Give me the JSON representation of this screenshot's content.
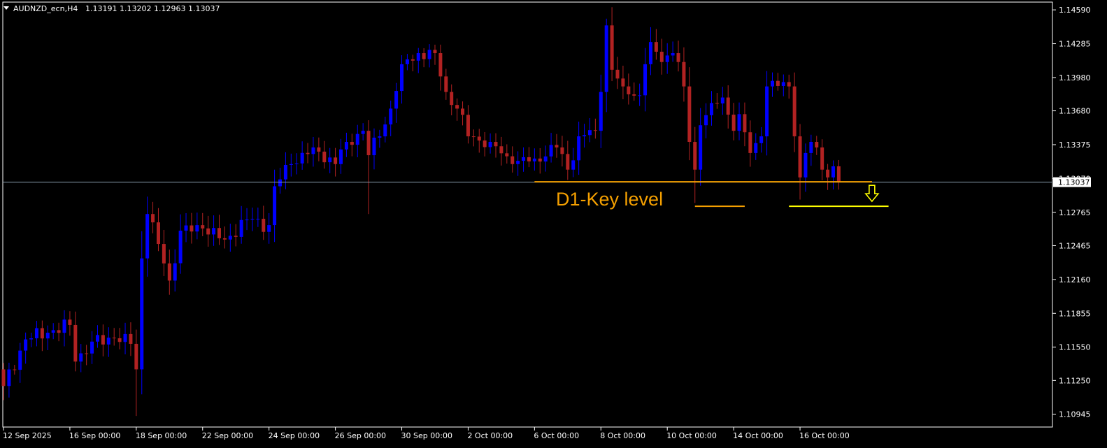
{
  "chart_data": {
    "type": "candlestick",
    "symbol_header": "AUDNZD_ecn,H4",
    "ohlc_header": "1.13191 1.13202 1.12963 1.13037",
    "current_price": 1.13037,
    "current_price_label": "1.13037",
    "ylim": [
      1.1083,
      1.1466
    ],
    "y_ticks": [
      {
        "value": 1.1459,
        "label": "1.14590"
      },
      {
        "value": 1.14285,
        "label": "1.14285"
      },
      {
        "value": 1.1398,
        "label": "1.13980"
      },
      {
        "value": 1.1368,
        "label": "1.13680"
      },
      {
        "value": 1.13375,
        "label": "1.13375"
      },
      {
        "value": 1.1307,
        "label": "1.13070"
      },
      {
        "value": 1.12765,
        "label": "1.12765"
      },
      {
        "value": 1.12465,
        "label": "1.12465"
      },
      {
        "value": 1.1216,
        "label": "1.12160"
      },
      {
        "value": 1.11855,
        "label": "1.11855"
      },
      {
        "value": 1.1155,
        "label": "1.11550"
      },
      {
        "value": 1.1125,
        "label": "1.11250"
      },
      {
        "value": 1.10945,
        "label": "1.10945"
      }
    ],
    "x_ticks": [
      {
        "index": 0,
        "label": "12 Sep 2025"
      },
      {
        "index": 12,
        "label": "16 Sep 00:00"
      },
      {
        "index": 24,
        "label": "18 Sep 00:00"
      },
      {
        "index": 36,
        "label": "22 Sep 00:00"
      },
      {
        "index": 48,
        "label": "24 Sep 00:00"
      },
      {
        "index": 60,
        "label": "26 Sep 00:00"
      },
      {
        "index": 72,
        "label": "30 Sep 00:00"
      },
      {
        "index": 84,
        "label": "2 Oct 00:00"
      },
      {
        "index": 96,
        "label": "6 Oct 00:00"
      },
      {
        "index": 108,
        "label": "8 Oct 00:00"
      },
      {
        "index": 120,
        "label": "10 Oct 00:00"
      },
      {
        "index": 132,
        "label": "14 Oct 00:00"
      },
      {
        "index": 144,
        "label": "16 Oct 00:00"
      }
    ],
    "bull_color": "#0000FF",
    "bear_color": "#B22222",
    "anchors": [
      [
        0,
        1.112
      ],
      [
        4,
        1.1162
      ],
      [
        8,
        1.1168
      ],
      [
        12,
        1.1175
      ],
      [
        13,
        1.1142
      ],
      [
        16,
        1.116
      ],
      [
        20,
        1.1163
      ],
      [
        23,
        1.1158
      ],
      [
        24,
        1.1135
      ],
      [
        25,
        1.1235
      ],
      [
        26,
        1.1275
      ],
      [
        28,
        1.1248
      ],
      [
        30,
        1.1215
      ],
      [
        32,
        1.126
      ],
      [
        36,
        1.1262
      ],
      [
        40,
        1.1252
      ],
      [
        44,
        1.127
      ],
      [
        48,
        1.1265
      ],
      [
        49,
        1.13
      ],
      [
        52,
        1.132
      ],
      [
        56,
        1.1335
      ],
      [
        60,
        1.132
      ],
      [
        62,
        1.134
      ],
      [
        65,
        1.135
      ],
      [
        66,
        1.1328
      ],
      [
        68,
        1.1345
      ],
      [
        70,
        1.137
      ],
      [
        72,
        1.141
      ],
      [
        75,
        1.142
      ],
      [
        78,
        1.142
      ],
      [
        80,
        1.1385
      ],
      [
        82,
        1.137
      ],
      [
        84,
        1.1345
      ],
      [
        88,
        1.134
      ],
      [
        92,
        1.132
      ],
      [
        96,
        1.1325
      ],
      [
        100,
        1.1335
      ],
      [
        102,
        1.1315
      ],
      [
        104,
        1.1345
      ],
      [
        107,
        1.135
      ],
      [
        108,
        1.1385
      ],
      [
        109,
        1.1445
      ],
      [
        110,
        1.1405
      ],
      [
        112,
        1.139
      ],
      [
        115,
        1.1382
      ],
      [
        116,
        1.141
      ],
      [
        117,
        1.143
      ],
      [
        119,
        1.1412
      ],
      [
        121,
        1.142
      ],
      [
        122,
        1.1412
      ],
      [
        123,
        1.139
      ],
      [
        124,
        1.134
      ],
      [
        125,
        1.1315
      ],
      [
        126,
        1.1355
      ],
      [
        128,
        1.1375
      ],
      [
        130,
        1.138
      ],
      [
        132,
        1.135
      ],
      [
        133,
        1.1365
      ],
      [
        135,
        1.133
      ],
      [
        137,
        1.1345
      ],
      [
        138,
        1.139
      ],
      [
        139,
        1.1395
      ],
      [
        142,
        1.139
      ],
      [
        143,
        1.1345
      ],
      [
        144,
        1.1308
      ],
      [
        145,
        1.133
      ],
      [
        146,
        1.134
      ],
      [
        147,
        1.1335
      ],
      [
        148,
        1.1315
      ],
      [
        149,
        1.1308
      ],
      [
        150,
        1.1318
      ],
      [
        151,
        1.13037
      ]
    ],
    "annotations": {
      "key_level_label": "D1-Key level",
      "key_level_price": 1.1304,
      "key_level_from_index": 96,
      "key_level_to_index": 156,
      "short_line_price": 1.1282,
      "short_line_from_index": 125,
      "short_line_to_index": 134,
      "target_line_price": 1.1282,
      "target_line_from_index": 142,
      "target_line_to_index": 160,
      "arrow_index": 157,
      "orange": "#F5A000",
      "yellow": "#FFFF00"
    }
  }
}
